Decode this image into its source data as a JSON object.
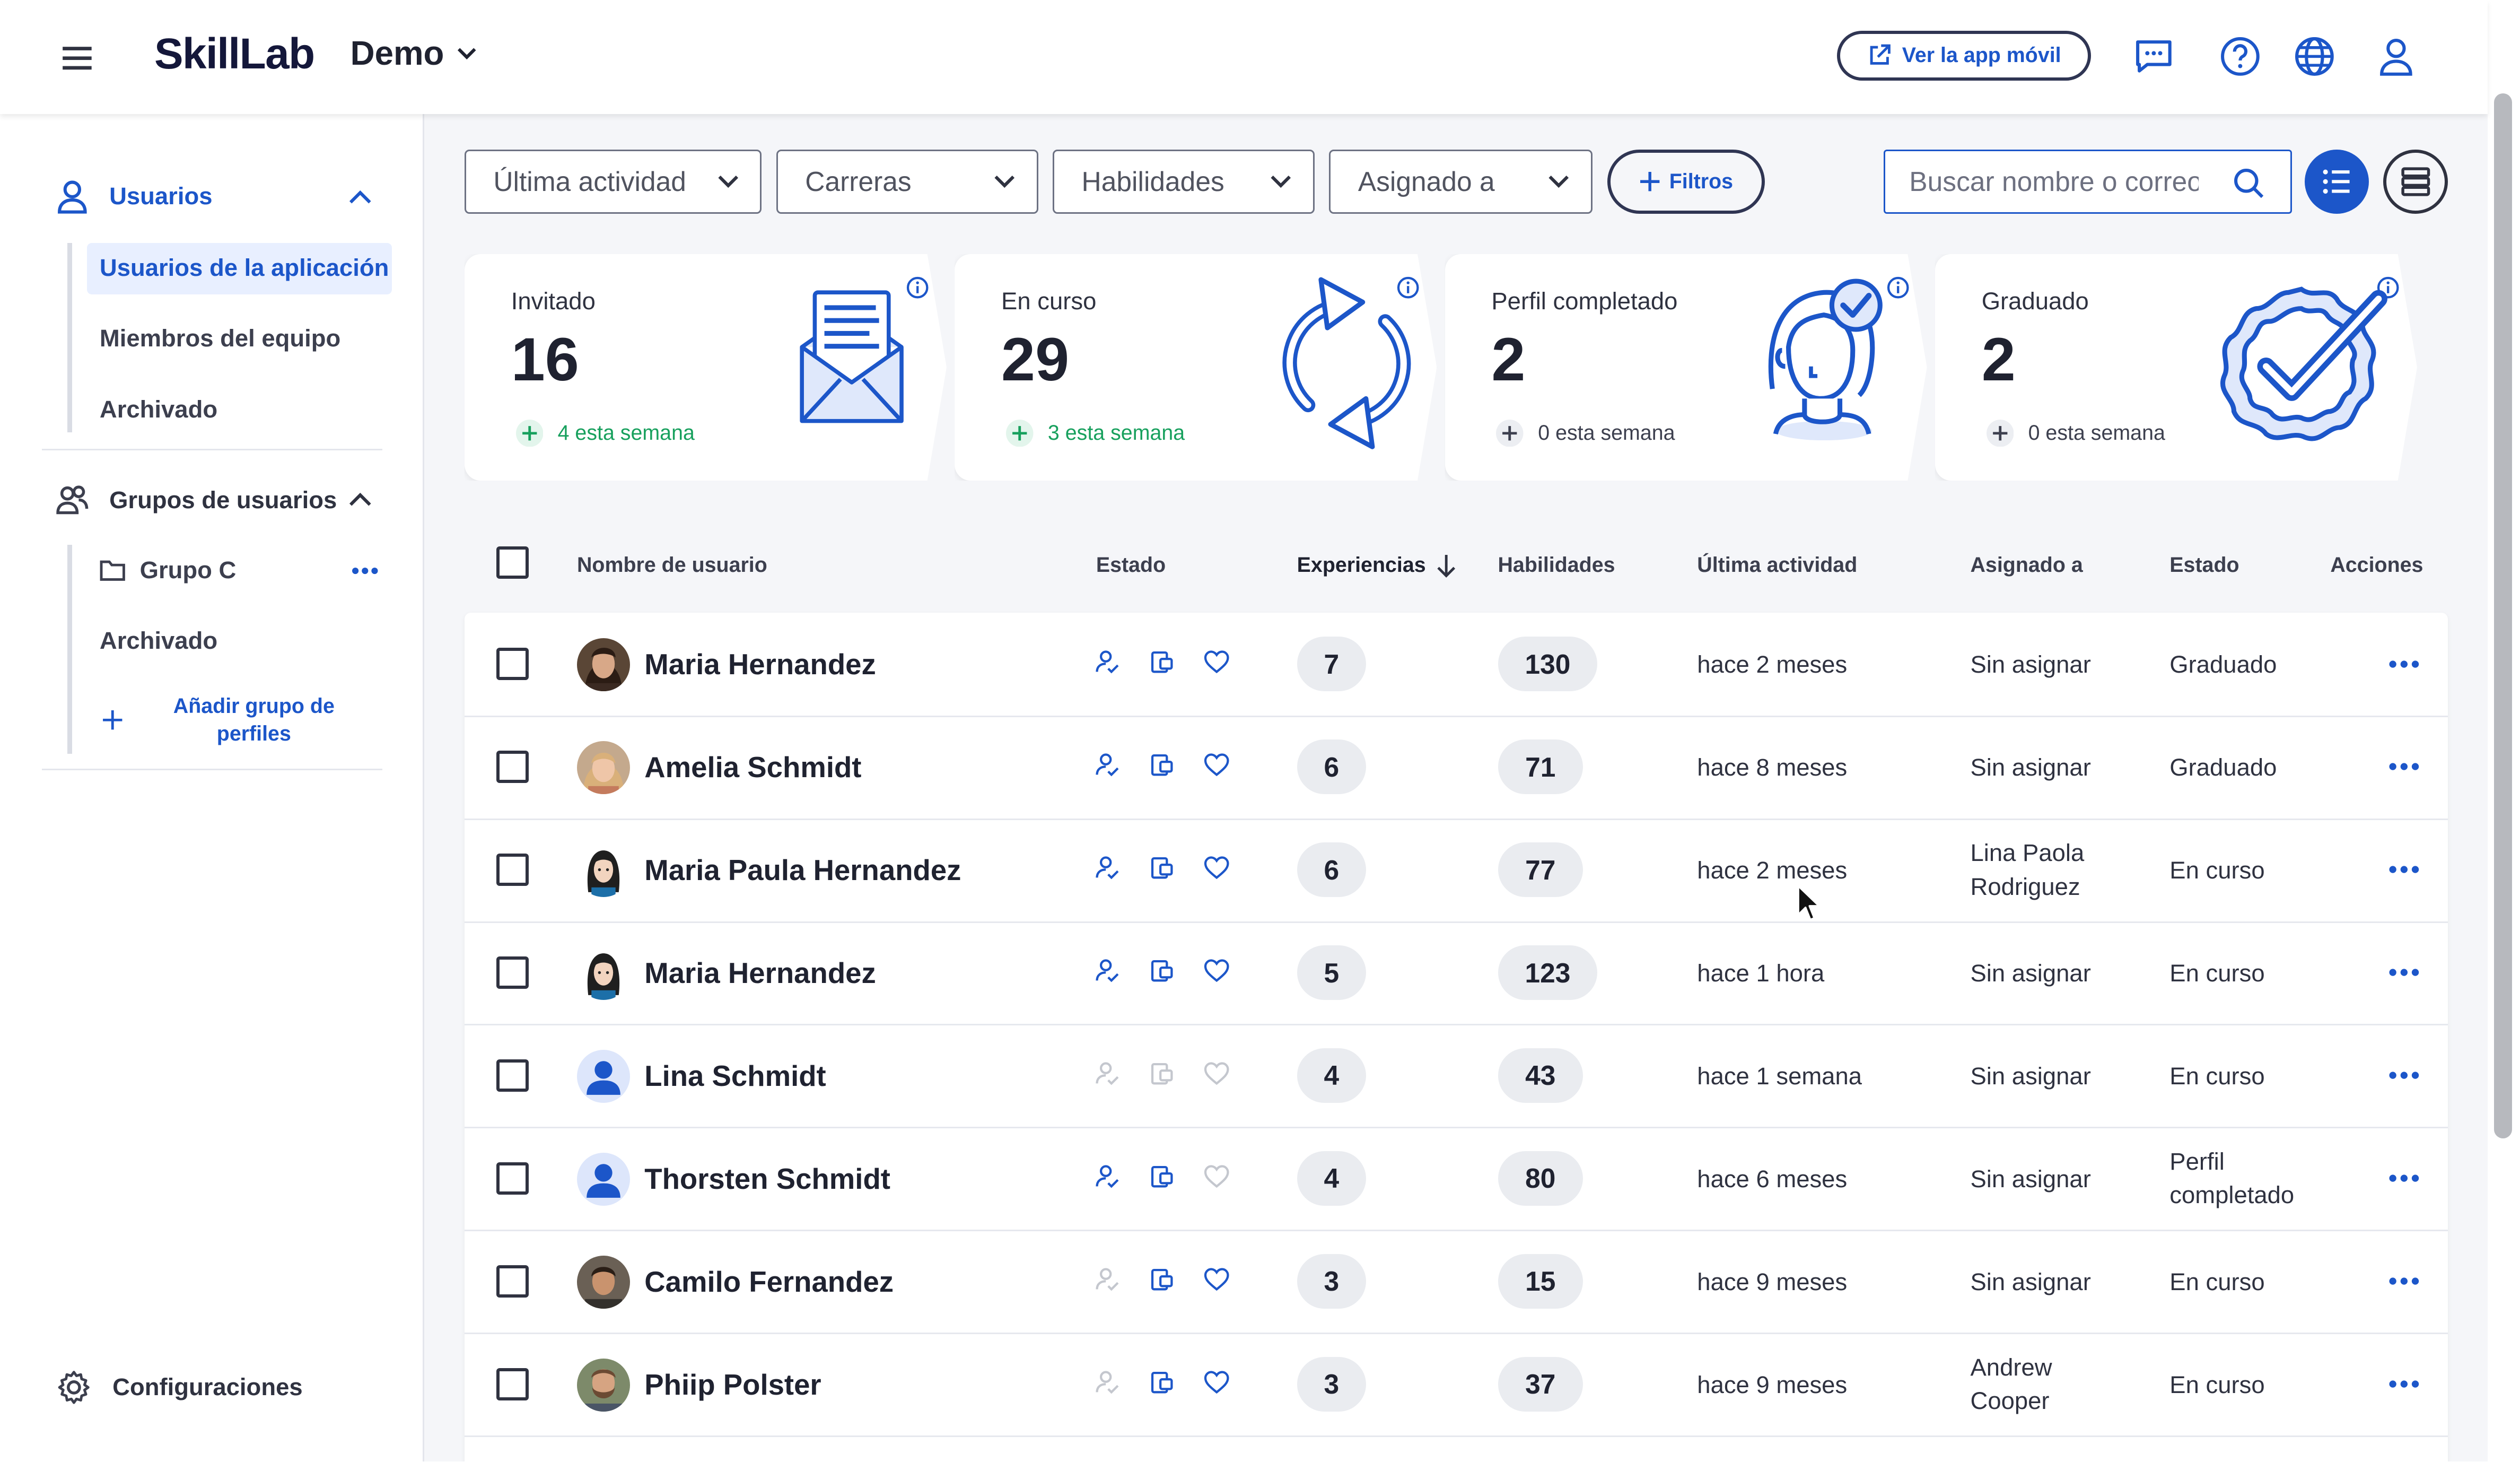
{
  "header": {
    "logo": "SkillLab",
    "org_name": "Demo",
    "mobile_app_button": "Ver la app móvil"
  },
  "sidebar": {
    "users_section": "Usuarios",
    "users_items": [
      {
        "label": "Usuarios de la aplicación",
        "active": true
      },
      {
        "label": "Miembros del equipo",
        "active": false
      },
      {
        "label": "Archivado",
        "active": false
      }
    ],
    "groups_section": "Grupos de usuarios",
    "group_name": "Grupo C",
    "groups_archived": "Archivado",
    "add_group": "Añadir grupo de perfiles",
    "settings": "Configuraciones"
  },
  "filters": {
    "last_activity": "Última actividad",
    "careers": "Carreras",
    "skills": "Habilidades",
    "assigned_to": "Asignado a",
    "filters_button": "Filtros",
    "search_placeholder": "Buscar nombre o correo"
  },
  "cards": [
    {
      "label": "Invitado",
      "count": "16",
      "week": "4 esta semana",
      "week_color": "#17a05d"
    },
    {
      "label": "En curso",
      "count": "29",
      "week": "3 esta semana",
      "week_color": "#17a05d"
    },
    {
      "label": "Perfil completado",
      "count": "2",
      "week": "0 esta semana",
      "week_color": "#3c3f4e"
    },
    {
      "label": "Graduado",
      "count": "2",
      "week": "0 esta semana",
      "week_color": "#3c3f4e"
    }
  ],
  "table": {
    "columns": [
      "Nombre de usuario",
      "Estado",
      "Experiencias",
      "Habilidades",
      "Última actividad",
      "Asignado a",
      "Estado",
      "Acciones"
    ],
    "rows": [
      {
        "name": "Maria Hernandez",
        "experiences": "7",
        "skills": "130",
        "last_activity": "hace 2 meses",
        "assigned": "Sin asignar",
        "status": "Graduado",
        "avatar": "photo-dark-hair-woman"
      },
      {
        "name": "Amelia Schmidt",
        "experiences": "6",
        "skills": "71",
        "last_activity": "hace 8 meses",
        "assigned": "Sin asignar",
        "status": "Graduado",
        "avatar": "photo-blonde-woman"
      },
      {
        "name": "Maria Paula Hernandez",
        "experiences": "6",
        "skills": "77",
        "last_activity": "hace 2 meses",
        "assigned": "Lina Paola Rodriguez",
        "status": "En curso",
        "avatar": "cartoon-woman"
      },
      {
        "name": "Maria Hernandez",
        "experiences": "5",
        "skills": "123",
        "last_activity": "hace 1 hora",
        "assigned": "Sin asignar",
        "status": "En curso",
        "avatar": "cartoon-woman"
      },
      {
        "name": "Lina Schmidt",
        "experiences": "4",
        "skills": "43",
        "last_activity": "hace 1 semana",
        "assigned": "Sin asignar",
        "status": "En curso",
        "avatar": "default-user"
      },
      {
        "name": "Thorsten Schmidt",
        "experiences": "4",
        "skills": "80",
        "last_activity": "hace 6 meses",
        "assigned": "Sin asignar",
        "status": "Perfil completado",
        "avatar": "default-user"
      },
      {
        "name": "Camilo Fernandez",
        "experiences": "3",
        "skills": "15",
        "last_activity": "hace 9 meses",
        "assigned": "Sin asignar",
        "status": "En curso",
        "avatar": "photo-man"
      },
      {
        "name": "Phiip Polster",
        "experiences": "3",
        "skills": "37",
        "last_activity": "hace 9 meses",
        "assigned": "Andrew Cooper",
        "status": "En curso",
        "avatar": "photo-bearded-man"
      }
    ]
  },
  "colors": {
    "accent": "#1c56c9",
    "green": "#17a05d",
    "text": "#1f2230"
  }
}
